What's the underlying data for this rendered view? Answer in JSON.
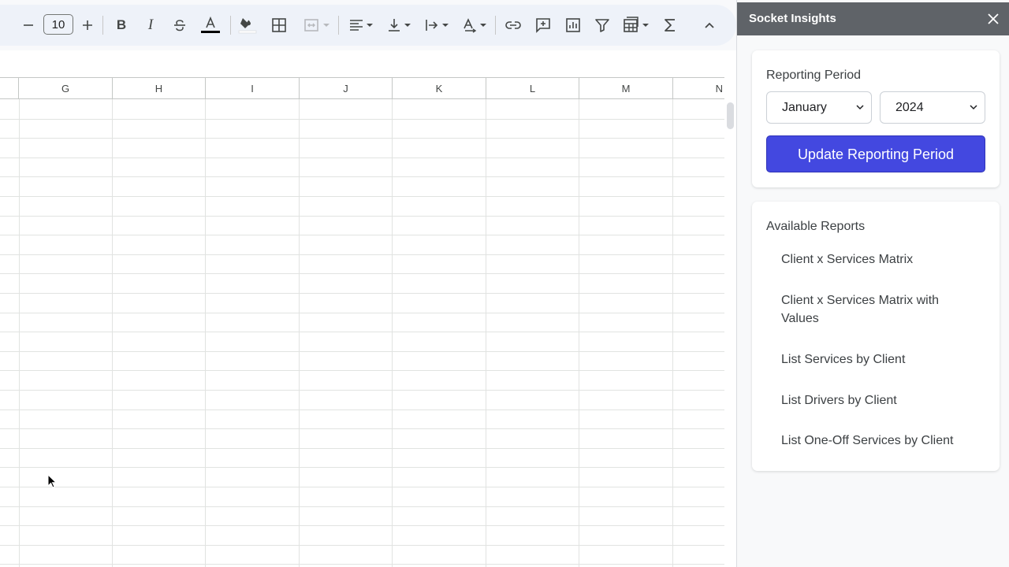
{
  "toolbar": {
    "font_size": "10",
    "bold_label": "B",
    "italic_label": "I"
  },
  "grid": {
    "columns": [
      "G",
      "H",
      "I",
      "J",
      "K",
      "L",
      "M",
      "N"
    ]
  },
  "panel": {
    "title": "Socket Insights",
    "reporting": {
      "title": "Reporting Period",
      "month": "January",
      "year": "2024",
      "update_label": "Update Reporting Period"
    },
    "reports": {
      "title": "Available Reports",
      "items": [
        "Client x Services Matrix",
        "Client x Services Matrix with Values",
        "List Services by Client",
        "List Drivers by Client",
        "List One-Off Services by Client"
      ]
    }
  },
  "colors": {
    "accent": "#4348e0",
    "panel_header": "#5f6368",
    "text_color_bar": "#000000"
  }
}
